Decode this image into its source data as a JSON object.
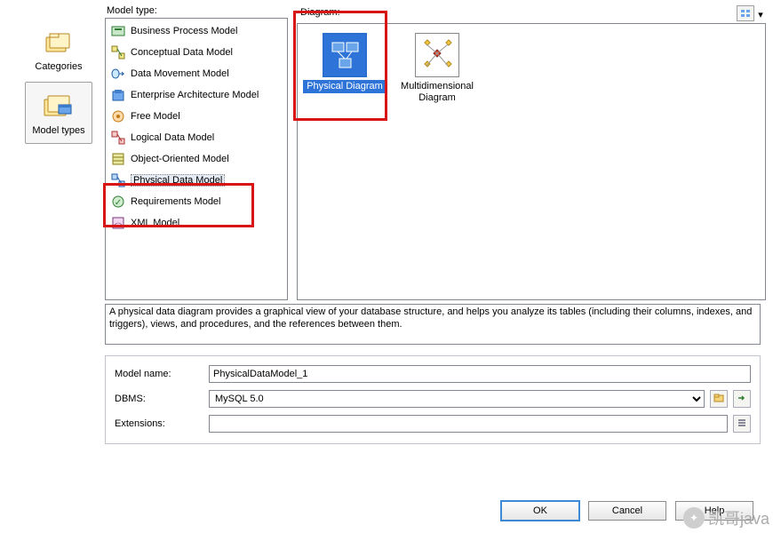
{
  "labels": {
    "model_type": "Model type:",
    "diagram": "Diagram:"
  },
  "left_nav": {
    "categories": "Categories",
    "model_types": "Model types",
    "selected": "model_types"
  },
  "model_types": [
    {
      "label": "Business Process Model"
    },
    {
      "label": "Conceptual Data Model"
    },
    {
      "label": "Data Movement Model"
    },
    {
      "label": "Enterprise Architecture Model"
    },
    {
      "label": "Free Model"
    },
    {
      "label": "Logical Data Model"
    },
    {
      "label": "Object-Oriented Model"
    },
    {
      "label": "Physical Data Model",
      "selected": true
    },
    {
      "label": "Requirements Model"
    },
    {
      "label": "XML Model"
    }
  ],
  "diagrams": [
    {
      "label": "Physical Diagram",
      "selected": true
    },
    {
      "label": "Multidimensional Diagram"
    }
  ],
  "description": "A physical data diagram provides a graphical view of your database structure, and helps you analyze its tables (including their columns, indexes, and triggers), views, and procedures, and the references between them.",
  "form": {
    "model_name_label": "Model name:",
    "model_name_value": "PhysicalDataModel_1",
    "dbms_label": "DBMS:",
    "dbms_value": "MySQL 5.0",
    "extensions_label": "Extensions:",
    "extensions_value": ""
  },
  "buttons": {
    "ok": "OK",
    "cancel": "Cancel",
    "help": "Help"
  },
  "watermark": "凯哥java"
}
